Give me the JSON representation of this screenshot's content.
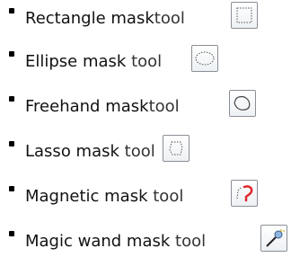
{
  "tools": [
    {
      "label": "Rectangle mask",
      "suffix": "tool",
      "icon": "rectangle-mask-icon"
    },
    {
      "label": "Ellipse mask",
      "suffix": "tool",
      "icon": "ellipse-mask-icon"
    },
    {
      "label": "Freehand mask",
      "suffix": "tool",
      "icon": "freehand-mask-icon"
    },
    {
      "label": "Lasso mask",
      "suffix": "tool",
      "icon": "lasso-mask-icon"
    },
    {
      "label": "Magnetic mask",
      "suffix": "tool",
      "icon": "magnetic-mask-icon"
    },
    {
      "label": "Magic wand mask",
      "suffix": "tool",
      "icon": "magic-wand-mask-icon"
    }
  ],
  "colors": {
    "icon_border": "#8a8f96",
    "magnetic_accent": "#e0262c"
  }
}
